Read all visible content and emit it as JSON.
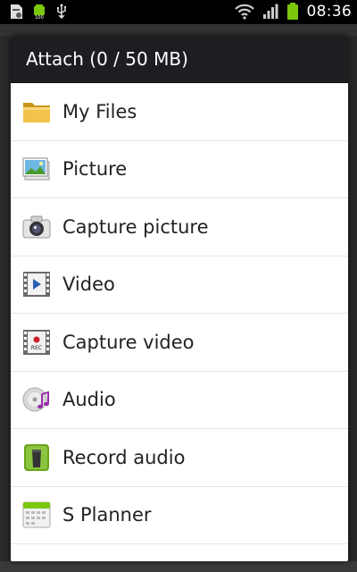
{
  "status_bar": {
    "time": "08:36",
    "left_icons": [
      "sd-card-icon",
      "battery-100-icon",
      "usb-icon"
    ],
    "right_icons": [
      "wifi-icon",
      "signal-icon",
      "battery-icon"
    ]
  },
  "dialog": {
    "title": "Attach (0 / 50 MB)",
    "items": [
      {
        "label": "My Files",
        "icon": "folder-icon"
      },
      {
        "label": "Picture",
        "icon": "picture-icon"
      },
      {
        "label": "Capture picture",
        "icon": "camera-icon"
      },
      {
        "label": "Video",
        "icon": "video-icon"
      },
      {
        "label": "Capture video",
        "icon": "video-rec-icon"
      },
      {
        "label": "Audio",
        "icon": "audio-icon"
      },
      {
        "label": "Record audio",
        "icon": "voice-recorder-icon"
      },
      {
        "label": "S Planner",
        "icon": "calendar-icon"
      }
    ]
  },
  "colors": {
    "title_bar": "#1c1e22",
    "dialog_bg": "#ffffff",
    "accent_green": "#7ac70c"
  }
}
